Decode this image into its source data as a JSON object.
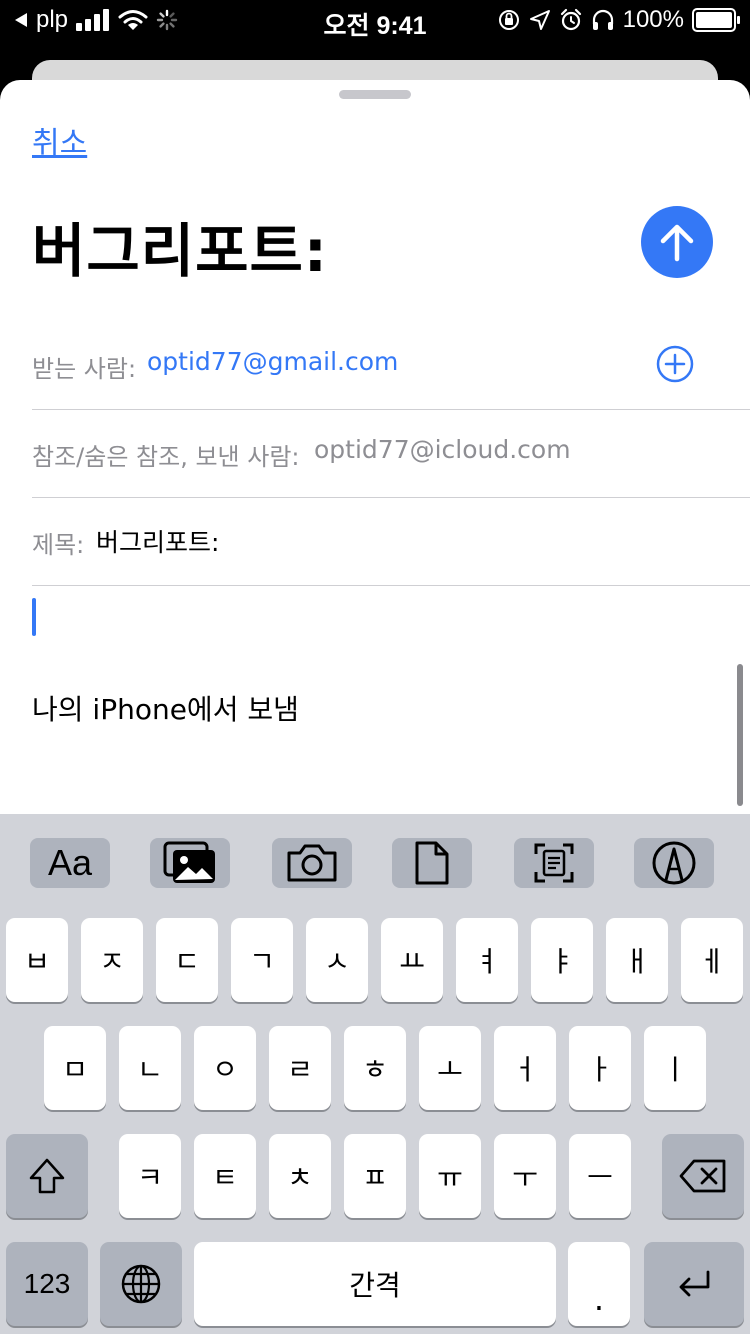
{
  "status_bar": {
    "carrier": "plp",
    "time": "오전 9:41",
    "battery": "100%"
  },
  "compose": {
    "cancel_label": "취소",
    "title": "버그리포트:",
    "to_label": "받는 사람:",
    "to_value": "optid77@gmail.com",
    "cc_label": "참조/숨은 참조, 보낸 사람:",
    "cc_value": "optid77@icloud.com",
    "subject_label": "제목:",
    "subject_value": "버그리포트:",
    "signature": "나의 iPhone에서 보냄"
  },
  "colors": {
    "accent": "#3478f6",
    "keyboard_bg": "#d1d3d9",
    "key_bg": "#ffffff",
    "key_dark_bg": "#aeb3bd"
  },
  "keyboard": {
    "toolbar_format_label": "Aa",
    "toolbar_icons": [
      "format-text-icon",
      "photo-library-icon",
      "camera-icon",
      "document-icon",
      "scan-document-icon",
      "markup-icon"
    ],
    "row1": [
      "ㅂ",
      "ㅈ",
      "ㄷ",
      "ㄱ",
      "ㅅ",
      "ㅛ",
      "ㅕ",
      "ㅑ",
      "ㅐ",
      "ㅔ"
    ],
    "row2": [
      "ㅁ",
      "ㄴ",
      "ㅇ",
      "ㄹ",
      "ㅎ",
      "ㅗ",
      "ㅓ",
      "ㅏ",
      "ㅣ"
    ],
    "row3": [
      "ㅋ",
      "ㅌ",
      "ㅊ",
      "ㅍ",
      "ㅠ",
      "ㅜ",
      "ㅡ"
    ],
    "numbers_label": "123",
    "space_label": "간격",
    "period_label": "."
  }
}
